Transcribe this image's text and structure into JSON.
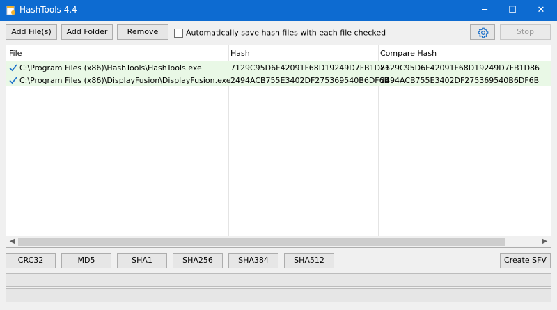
{
  "window": {
    "title": "HashTools 4.4",
    "minimize": "─",
    "maximize": "☐",
    "close": "✕"
  },
  "toolbar": {
    "add_files": "Add File(s)",
    "add_folder": "Add Folder",
    "remove": "Remove",
    "autosave_label": "Automatically save hash files with each file checked",
    "autosave_checked": false,
    "stop": "Stop"
  },
  "list": {
    "columns": [
      "File",
      "Hash",
      "Compare Hash"
    ],
    "rows": [
      {
        "file": "C:\\Program Files (x86)\\HashTools\\HashTools.exe",
        "hash": "7129C95D6F42091F68D19249D7FB1D86",
        "compare": "7129C95D6F42091F68D19249D7FB1D86",
        "status": "match"
      },
      {
        "file": "C:\\Program Files (x86)\\DisplayFusion\\DisplayFusion.exe",
        "hash": "2494ACB755E3402DF275369540B6DF6B",
        "compare": "2494ACB755E3402DF275369540B6DF6B",
        "status": "match"
      }
    ]
  },
  "hash_buttons": [
    "CRC32",
    "MD5",
    "SHA1",
    "SHA256",
    "SHA384",
    "SHA512"
  ],
  "create_sfv": "Create SFV",
  "colors": {
    "titlebar": "#0d6bd1",
    "row_match": "#e9f8e6",
    "check": "#1a6fc9"
  }
}
